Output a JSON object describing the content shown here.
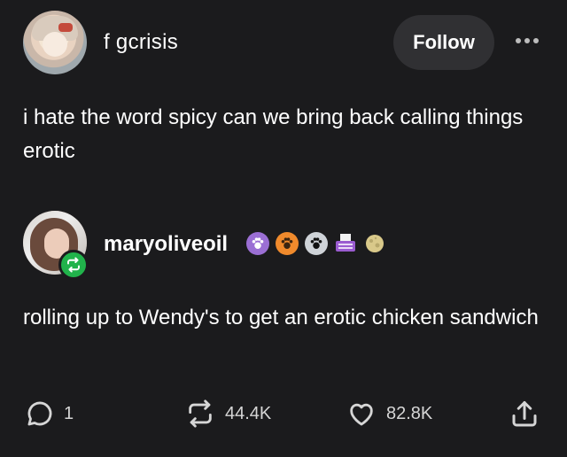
{
  "post": {
    "author": "f gcrisis",
    "follow_label": "Follow",
    "text": "i hate the word spicy can we bring back calling things erotic"
  },
  "reblog": {
    "author": "maryoliveoil",
    "text": "rolling up to Wendy's to get an erotic chicken sandwich",
    "badges": [
      "paw-badge-purple",
      "paw-badge-orange",
      "paw-badge-dark",
      "typewriter-badge",
      "moon-badge"
    ]
  },
  "actions": {
    "replies": "1",
    "reblogs": "44.4K",
    "likes": "82.8K"
  },
  "colors": {
    "background": "#1b1b1d",
    "follow_button": "#303033",
    "reblog_green": "#21b34b"
  }
}
